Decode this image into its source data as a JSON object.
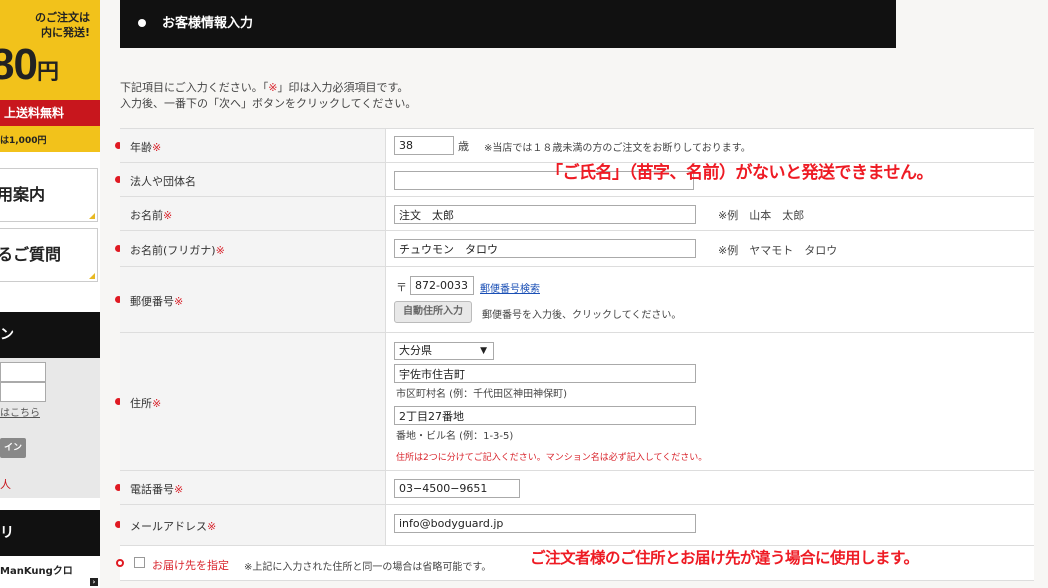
{
  "sidebar": {
    "promo_line1": "のご注文は",
    "promo_line2": "内に発送!",
    "promo_big": "80",
    "promo_unit": "円",
    "promo_red": "上送料無料",
    "promo_small": "は1,000円",
    "box1": "用案内",
    "box2": "るご質問",
    "dark1": "ン",
    "login_link": "はこちら",
    "login_btn": "イン",
    "login_red": "人",
    "dark2": "リ",
    "bottom_item": "ManKungクロ"
  },
  "header": {
    "title": "お客様情報入力"
  },
  "intro": {
    "line1_a": "下記項目にご入力ください。「",
    "line1_mark": "※",
    "line1_b": "」印は入力必須項目です。",
    "line2": "入力後、一番下の「次へ」ボタンをクリックしてください。"
  },
  "form": {
    "required_mark": "※",
    "age": {
      "label": "年齢",
      "value": "38",
      "unit": "歳",
      "note": "※当店では１８歳未満の方のご注文をお断りしております。"
    },
    "company": {
      "label": "法人や団体名",
      "value": ""
    },
    "name": {
      "label": "お名前",
      "value": "注文　太郎",
      "example": "※例　山本　太郎"
    },
    "name_kana": {
      "label": "お名前(フリガナ)",
      "value": "チュウモン　タロウ",
      "example": "※例　ヤマモト　タロウ"
    },
    "postal": {
      "label": "郵便番号",
      "prefix": "〒",
      "value": "872-0033",
      "search_link": "郵便番号検索",
      "auto_button": "自動住所入力",
      "auto_note": "郵便番号を入力後、クリックしてください。"
    },
    "address": {
      "label": "住所",
      "prefecture": "大分県",
      "city_value": "宇佐市住吉町",
      "city_hint": "市区町村名 (例：千代田区神田神保町)",
      "street_value": "2丁目27番地",
      "street_hint": "番地・ビル名 (例：1-3-5)",
      "warning": "住所は2つに分けてご記入ください。マンション名は必ず記入してください。"
    },
    "phone": {
      "label": "電話番号",
      "value": "03−4500−9651"
    },
    "email": {
      "label": "メールアドレス",
      "value": "info@bodyguard.jp"
    },
    "delivery": {
      "label": "お届け先を指定",
      "note": "※上記に入力された住所と同一の場合は省略可能です。"
    }
  },
  "annotations": {
    "name_warning": "「ご氏名」（苗字、名前）がないと発送できません。",
    "delivery_hint": "ご注文者様のご住所とお届け先が違う場合に使用します。"
  },
  "colors": {
    "accent_red": "#e01a22",
    "header_bg": "#111111",
    "promo_yellow": "#f2c21b"
  }
}
